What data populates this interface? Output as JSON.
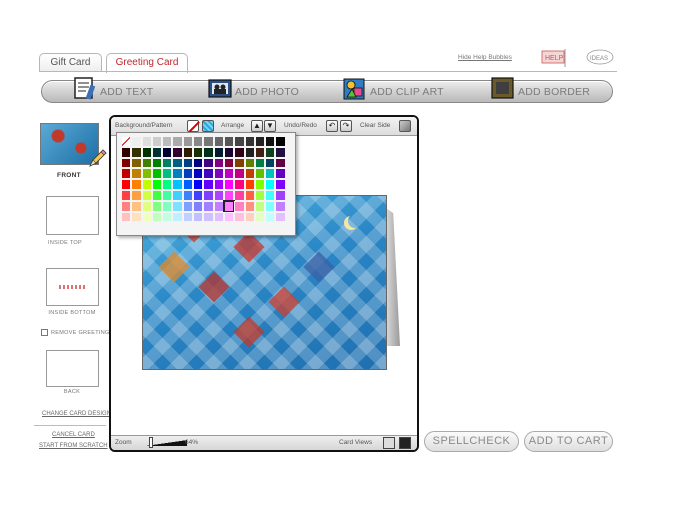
{
  "tabs": {
    "gift": "Gift Card",
    "greeting": "Greeting Card"
  },
  "help": {
    "hide_link": "Hide Help Bubbles",
    "help_icon": "help-flag-icon",
    "ideas_icon": "ideas-cloud-icon"
  },
  "toolbar": {
    "add_text": "ADD TEXT",
    "add_photo": "ADD PHOTO",
    "add_clip_art": "ADD CLIP ART",
    "add_border": "ADD BORDER"
  },
  "sides": {
    "front": "FRONT",
    "inside_top": "INSIDE TOP",
    "inside_bottom": "INSIDE BOTTOM",
    "remove_greeting": "REMOVE GREETING",
    "back": "BACK"
  },
  "links": {
    "change_design": "CHANGE CARD DESIGN",
    "cancel_card": "CANCEL CARD",
    "start_scratch": "START FROM SCRATCH"
  },
  "editor": {
    "background_label": "Background/Pattern",
    "arrange_label": "Arrange",
    "undo_label": "Undo/Redo",
    "clear_label": "Clear Side",
    "zoom_label": "Zoom",
    "zoom_value": "64%",
    "zoom_level": 0.64,
    "views_label": "Card Views"
  },
  "palette": {
    "selected_index": 106,
    "colors": [
      "#ffffff",
      "#eeeeee",
      "#dddddd",
      "#cccccc",
      "#bbbbbb",
      "#aaaaaa",
      "#999999",
      "#888888",
      "#777777",
      "#666666",
      "#555555",
      "#444444",
      "#333333",
      "#222222",
      "#111111",
      "#000000",
      "#300000",
      "#303000",
      "#003000",
      "#003030",
      "#000030",
      "#300030",
      "#301800",
      "#183000",
      "#003018",
      "#001830",
      "#180030",
      "#300018",
      "#202020",
      "#402010",
      "#104020",
      "#201040",
      "#800000",
      "#806000",
      "#408000",
      "#008000",
      "#008060",
      "#006080",
      "#004080",
      "#000080",
      "#400080",
      "#800080",
      "#800040",
      "#804000",
      "#608000",
      "#008040",
      "#004060",
      "#600040",
      "#c00000",
      "#c08000",
      "#80c000",
      "#00c000",
      "#00c080",
      "#0080c0",
      "#0040c0",
      "#0000c0",
      "#4000c0",
      "#8000c0",
      "#c000c0",
      "#c00080",
      "#c04000",
      "#60c000",
      "#00c0c0",
      "#6000c0",
      "#ff0000",
      "#ff8000",
      "#c0ff00",
      "#00ff00",
      "#00ff80",
      "#00c0ff",
      "#0060ff",
      "#0000ff",
      "#6000ff",
      "#a000ff",
      "#ff00ff",
      "#ff0080",
      "#ff4000",
      "#80ff00",
      "#00ffff",
      "#8000ff",
      "#ff4040",
      "#ffa040",
      "#d0ff40",
      "#40ff40",
      "#40ffa0",
      "#40d0ff",
      "#4080ff",
      "#4040ff",
      "#8040ff",
      "#b040ff",
      "#ff40ff",
      "#ff40a0",
      "#ff6040",
      "#a0ff40",
      "#40ffff",
      "#a040ff",
      "#ff8080",
      "#ffc080",
      "#e0ff80",
      "#80ff80",
      "#80ffc0",
      "#80e0ff",
      "#80a0ff",
      "#8080ff",
      "#a080ff",
      "#c080ff",
      "#ff80ff",
      "#ff80c0",
      "#ff9080",
      "#c0ff80",
      "#80ffff",
      "#c080ff",
      "#ffc0c0",
      "#ffe0c0",
      "#f0ffc0",
      "#c0ffc0",
      "#c0ffe0",
      "#c0f0ff",
      "#c0d0ff",
      "#c0c0ff",
      "#d0c0ff",
      "#e0c0ff",
      "#ffc0ff",
      "#ffc0e0",
      "#ffd0c0",
      "#e0ffc0",
      "#c0ffff",
      "#e0c0ff"
    ]
  },
  "buttons": {
    "spellcheck": "SPELLCHECK",
    "add_to_cart": "ADD TO CART"
  },
  "colors": {
    "accent": "#c0272d",
    "editor_border": "#111111"
  }
}
